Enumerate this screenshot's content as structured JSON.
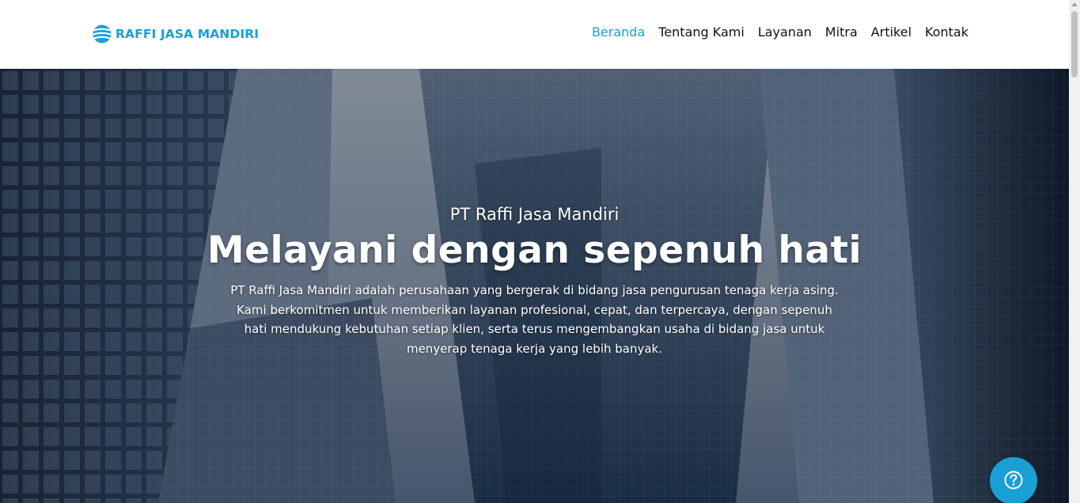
{
  "brand": {
    "name": "RAFFI JASA MANDIRI",
    "logo_icon": "globe-stripes-icon",
    "color": "#1a9fd5"
  },
  "nav": {
    "items": [
      {
        "label": "Beranda",
        "active": true
      },
      {
        "label": "Tentang Kami",
        "active": false
      },
      {
        "label": "Layanan",
        "active": false
      },
      {
        "label": "Mitra",
        "active": false
      },
      {
        "label": "Artikel",
        "active": false
      },
      {
        "label": "Kontak",
        "active": false
      }
    ]
  },
  "hero": {
    "subtitle": "PT Raffi Jasa Mandiri",
    "title": "Melayani dengan sepenuh hati",
    "description": "PT Raffi Jasa Mandiri adalah perusahaan yang bergerak di bidang jasa pengurusan tenaga kerja asing. Kami berkomitmen untuk memberikan layanan profesional, cepat, dan terpercaya, dengan sepenuh hati mendukung kebutuhan setiap klien, serta terus mengembangkan usaha di bidang jasa untuk menyerap tenaga kerja yang lebih banyak.",
    "background": "city-skyscrapers-photo"
  },
  "help_button": {
    "icon": "question-mark-circle-icon"
  }
}
